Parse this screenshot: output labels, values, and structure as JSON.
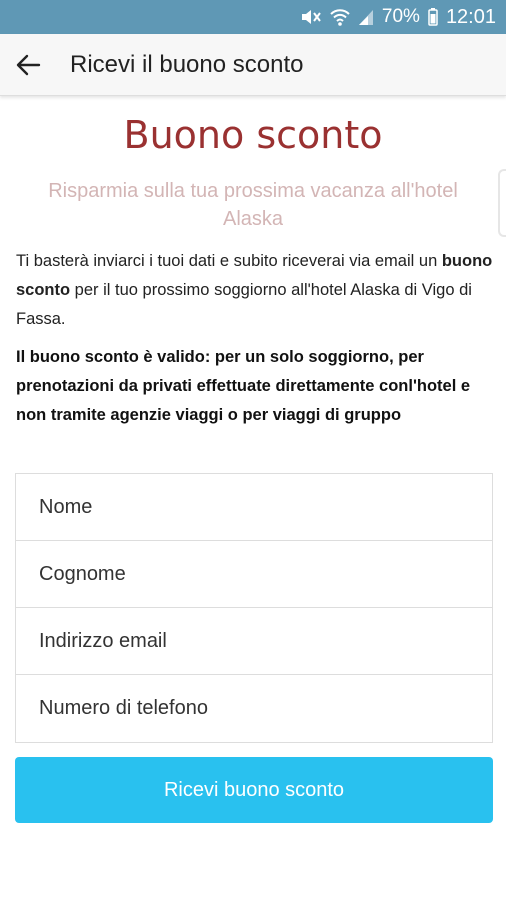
{
  "status_bar": {
    "battery": "70%",
    "time": "12:01",
    "icons": [
      "mute-icon",
      "wifi-icon",
      "signal-icon",
      "battery-icon"
    ]
  },
  "app_bar": {
    "title": "Ricevi il buono sconto",
    "back_icon": "arrow-left-icon"
  },
  "main": {
    "heading": "Buono sconto",
    "subheading": "Risparmia sulla tua prossima vacanza all'hotel Alaska",
    "intro_before": "Ti basterà inviarci i tuoi dati e subito riceverai via email un ",
    "intro_bold": "buono sconto",
    "intro_after": " per il tuo prossimo soggiorno all'hotel Alaska di Vigo di Fassa.",
    "notice": "Il buono sconto è valido: per un solo soggiorno, per prenotazioni da privati effettuate direttamente conl'hotel e non tramite agenzie viaggi o per viaggi di gruppo"
  },
  "form": {
    "nome_placeholder": "Nome",
    "cognome_placeholder": "Cognome",
    "email_placeholder": "Indirizzo email",
    "telefono_placeholder": "Numero di telefono",
    "submit_label": "Ricevi buono sconto"
  },
  "colors": {
    "status_bar": "#5f98b5",
    "heading": "#9a3131",
    "subheading": "#d3b5b5",
    "button": "#29c1ef"
  }
}
